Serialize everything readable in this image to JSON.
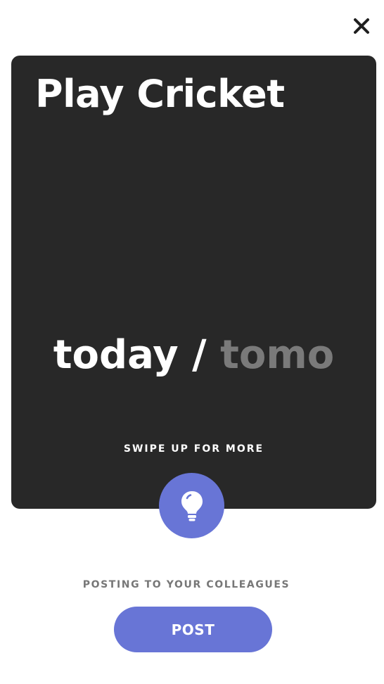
{
  "header": {
    "close_icon": "close-icon"
  },
  "card": {
    "title": "Play Cricket",
    "day_options": {
      "active": "today",
      "separator": " / ",
      "inactive": "tomo"
    },
    "swipe_hint": "SWIPE UP FOR MORE",
    "background_color": "#282828"
  },
  "idea_button": {
    "icon": "lightbulb-icon",
    "color": "#6875D6"
  },
  "footer": {
    "posting_label": "POSTING TO YOUR COLLEAGUES",
    "post_label": "POST",
    "accent_color": "#6875D6"
  }
}
